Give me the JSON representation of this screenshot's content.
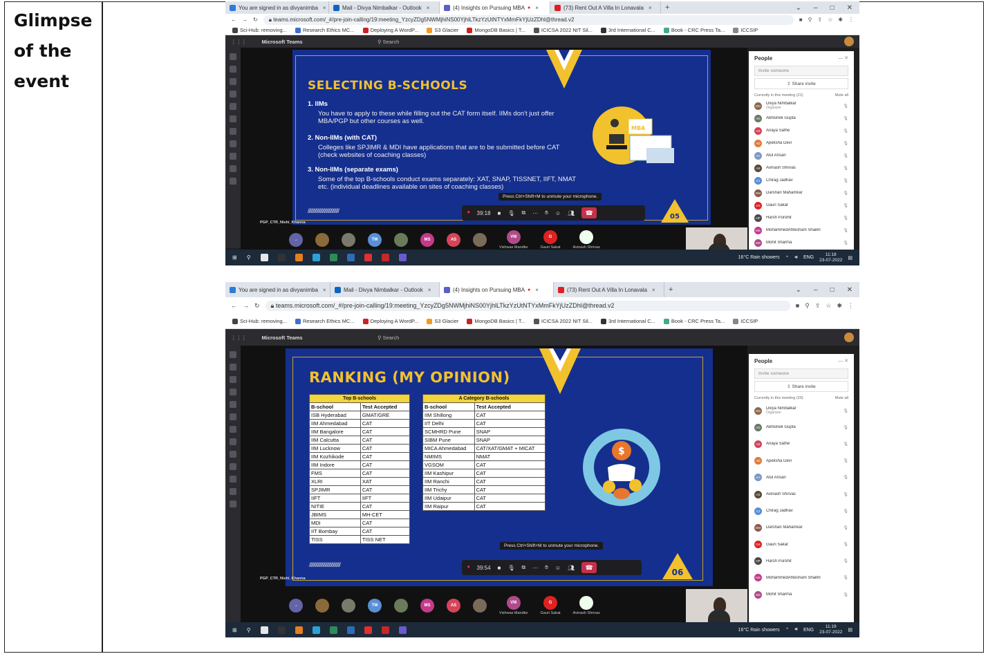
{
  "label": {
    "line1": "Glimpse",
    "line2": "of the",
    "line3": "event"
  },
  "browser": {
    "tabs": [
      {
        "label": "You are signed in as divyanimba",
        "color": "#2e7bd6"
      },
      {
        "label": "Mail - Divya Nimbalkar - Outlook",
        "color": "#0a66c2"
      },
      {
        "label": "(4) Insights on Pursuing MBA",
        "color": "#5b5fc7",
        "active": true
      },
      {
        "label": "(73) Rent Out A Villa In Lonavala",
        "color": "#e02020"
      }
    ],
    "new_tab": "+",
    "url_1": "teams.microsoft.com/_#/pre-join-calling/19:meeting_YzcyZDg5NWMjhiNS00YjhlLTkzYzUtNTYxMmFkYjUzZDhl@thread.v2",
    "url_2": "teams.microsoft.com/_#/pre-join-calling/19:meeting_YzcyZDg5NWMjhiNS00YjhlLTkzYzUtNTYxMmFkYjUzZDhl@thread.v2",
    "bookmarks": [
      "Sci-Hub: removing...",
      "Research Ethics MC...",
      "Deploying A WordP...",
      "S3 Glacier",
      "MongoDB Basics | T...",
      "ICICSA 2022 NIT Sil...",
      "3rd International C...",
      "Book - CRC Press Ta...",
      "ICCSIP"
    ],
    "bookmark_colors": [
      "#444",
      "#3b6fd1",
      "#c22",
      "#f39a1e",
      "#c22",
      "#555",
      "#333",
      "#4a8",
      "#888"
    ]
  },
  "teams": {
    "app_name": "Microsoft Teams",
    "search_placeholder": "Search"
  },
  "slide1": {
    "title": "SELECTING B-SCHOOLS",
    "items": [
      {
        "heading": "1.  IIMs",
        "text": "You have to apply to these while filling out the CAT form itself. IIMs don't just offer MBA/PGP but other courses as well."
      },
      {
        "heading": "2.  Non-IIMs (with CAT)",
        "text": "Colleges like SPJIMR & MDI have applications that are to be submitted before CAT (check websites of coaching classes)"
      },
      {
        "heading": "3.  Non-IIMs (separate exams)",
        "text": "Some of the top B-schools conduct exams separately: XAT, SNAP, TISSNET, IIFT, NMAT etc. (individual deadlines available on sites of coaching classes)"
      }
    ],
    "page_number": "05",
    "illustration_label": "MBA"
  },
  "slide2": {
    "title": "RANKING (MY OPINION)",
    "page_number": "06",
    "table_top": {
      "caption": "Top B-schools",
      "headers": [
        "B-school",
        "Test Accepted"
      ],
      "rows": [
        [
          "ISB Hyderabad",
          "GMAT/GRE"
        ],
        [
          "IIM Ahmedabad",
          "CAT"
        ],
        [
          "IIM Bangalore",
          "CAT"
        ],
        [
          "IIM Calcutta",
          "CAT"
        ],
        [
          "IIM Lucknow",
          "CAT"
        ],
        [
          "IIM Kozhikode",
          "CAT"
        ],
        [
          "IIM Indore",
          "CAT"
        ],
        [
          "FMS",
          "CAT"
        ],
        [
          "XLRI",
          "XAT"
        ],
        [
          "SPJIMR",
          "CAT"
        ],
        [
          "IIFT",
          "IIFT"
        ],
        [
          "NITIE",
          "CAT"
        ],
        [
          "JBIMS",
          "MH-CET"
        ],
        [
          "MDI",
          "CAT"
        ],
        [
          "IIT Bombay",
          "CAT"
        ],
        [
          "TISS",
          "TISS NET"
        ]
      ]
    },
    "table_a": {
      "caption": "A Category B-schools",
      "headers": [
        "B-school",
        "Test Accepted"
      ],
      "rows": [
        [
          "IIM Shillong",
          "CAT"
        ],
        [
          "IIT Delhi",
          "CAT"
        ],
        [
          "SCMHRD Pune",
          "SNAP"
        ],
        [
          "SIBM Pune",
          "SNAP"
        ],
        [
          "MICA Ahmedabad",
          "CAT/XAT/GMAT + MICAT"
        ],
        [
          "NMIMS",
          "NMAT"
        ],
        [
          "VGSOM",
          "CAT"
        ],
        [
          "IIM Kashipur",
          "CAT"
        ],
        [
          "IIM Ranchi",
          "CAT"
        ],
        [
          "IIM Trichy",
          "CAT"
        ],
        [
          "IIM Udaipur",
          "CAT"
        ],
        [
          "IIM Raipur",
          "CAT"
        ]
      ]
    }
  },
  "meeting": {
    "mic_tip": "Press Ctrl+Shift+M to unmute your microphone.",
    "timer_1": "39:18",
    "timer_2": "39:54",
    "stage_label": "PGP_CTR_Nishi_Khanna",
    "gallery": [
      {
        "initials": "→",
        "color": "#6264a7"
      },
      {
        "initials": "",
        "color": "#8a6a3a"
      },
      {
        "initials": "",
        "color": "#7a7a6a"
      },
      {
        "initials": "TM",
        "color": "#5b8fd6"
      },
      {
        "initials": "",
        "color": "#6a7a5a"
      },
      {
        "initials": "MS",
        "color": "#c43a8a"
      },
      {
        "initials": "AS",
        "color": "#d6445a"
      },
      {
        "initials": "",
        "color": "#7a6a5a"
      }
    ],
    "video_tiles": [
      {
        "initials": "VM",
        "name": "Vishwas Mandke",
        "color": "#b04a8a"
      },
      {
        "initials": "G",
        "name": "Gauri Sakat",
        "color": "#d22"
      },
      {
        "initials": "",
        "name": "Avinash Shrivas",
        "color": "#efe"
      }
    ]
  },
  "people_panel": {
    "title": "People",
    "invite_placeholder": "Invite someone",
    "share_invite": "Share invite",
    "current_label_1": "Currently in this meeting (21)",
    "current_label_2": "Currently in this meeting (20)",
    "mute_all": "Mute all",
    "participants": [
      {
        "name": "Divya Nimbalkar",
        "role": "Organizer",
        "initials": "DN",
        "color": "#8a6a4a"
      },
      {
        "name": "Abhishek Gupta",
        "initials": "AG",
        "color": "#6a7a6a"
      },
      {
        "name": "Anaya Sathe",
        "initials": "AS",
        "color": "#d6445a"
      },
      {
        "name": "Apeksha Devi",
        "initials": "AD",
        "color": "#e07a3a"
      },
      {
        "name": "Atul Ansari",
        "initials": "AA",
        "color": "#7a9ac4"
      },
      {
        "name": "Avinash Shrivas",
        "initials": "AS",
        "color": "#5a4a3a"
      },
      {
        "name": "Chirag Jadhav",
        "initials": "CJ",
        "color": "#5b8fd6"
      },
      {
        "name": "Darshan Mahamkar",
        "initials": "DM",
        "color": "#8a5a4a"
      },
      {
        "name": "Gauri Sakat",
        "initials": "GS",
        "color": "#d22"
      },
      {
        "name": "Harsh Purohit",
        "initials": "HP",
        "color": "#4a4a4a"
      },
      {
        "name": "MohammedAhtesham Shaikh",
        "initials": "MS",
        "color": "#c43a8a"
      },
      {
        "name": "Mohit Sharma",
        "initials": "MS",
        "color": "#b04a8a"
      }
    ]
  },
  "taskbar": {
    "weather": "16°C  Rain showers",
    "lang": "ENG",
    "time_1": "11:18",
    "time_2": "11:19",
    "date": "23-07-2022",
    "app_colors": [
      "#e6e6e6",
      "#333",
      "#e67e22",
      "#2ea0d8",
      "#2e8b57",
      "#2e6db4",
      "#e03030",
      "#c62828",
      "#6a5acd"
    ]
  }
}
